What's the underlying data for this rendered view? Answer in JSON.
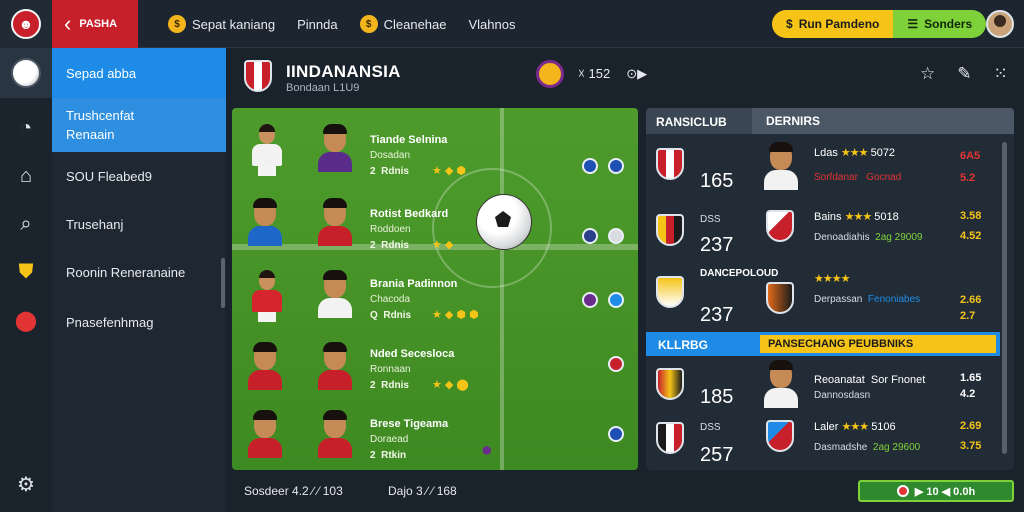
{
  "topbar": {
    "brand": "ᵹ̸ʜ",
    "brand_label": "PASHA",
    "nav": [
      {
        "label": "Sepat kaniang",
        "icon": "coin-icon"
      },
      {
        "label": "Pinnda",
        "icon": ""
      },
      {
        "label": "Cleanehae",
        "icon": "coin-icon"
      },
      {
        "label": "Vlahnos",
        "icon": ""
      }
    ],
    "pill_yellow": "Run Pamdeno",
    "pill_green": "Sonders"
  },
  "sidebar": {
    "items": [
      {
        "label": "Sepad abba"
      },
      {
        "label": "Trushcenfat Renaain"
      },
      {
        "label": "SOU Fleabed9"
      },
      {
        "label": "Trusehanj"
      },
      {
        "label": "Roonin Reneranaine"
      },
      {
        "label": "Pnasefenhmag"
      }
    ]
  },
  "header": {
    "title": "IINDANANSIA",
    "subtitle": "Bondaan L1U9",
    "stat_a": "☓ 152",
    "stat_b": "⊙▶"
  },
  "players": [
    {
      "name": "Tiande Selnina",
      "pos": "Dosadan",
      "num": "2",
      "extra": "Rdnis",
      "shirt": "#f2f2f2",
      "face_shirt": "#5a2c8a"
    },
    {
      "name": "Rotist Bedkard",
      "pos": "Roddoen",
      "num": "2",
      "extra": "Rdnis",
      "shirt": "#1d67c9",
      "face_shirt": "#c8202b"
    },
    {
      "name": "Brania Padinnon",
      "pos": "Chacoda",
      "num": "Q",
      "extra": "Rdnis",
      "shirt": "#d6252c",
      "face_shirt": "#f2f2f2"
    },
    {
      "name": "Nded Secesloca",
      "pos": "Ronnaan",
      "num": "2",
      "extra": "Rdnis",
      "shirt": "#c8202b",
      "face_shirt": "#c8202b"
    },
    {
      "name": "Brese Tigeama",
      "pos": "Doraead",
      "num": "2",
      "extra": "Rtkin",
      "shirt": "#c8202b",
      "face_shirt": "#c8202b"
    }
  ],
  "rpanel": {
    "tab_left": "RANSICLUB",
    "tab_right": "DERNIRS",
    "highlight_left": "KLLRBG",
    "highlight_right": "PANSECHANG PEUBBNIKS",
    "rows": [
      {
        "code": "",
        "big": "165",
        "line1": "Ldas",
        "stars": "★★★",
        "score": "5072",
        "line2": "Sorfdanar",
        "line2b": "Gocnad",
        "v1": "6A5",
        "v2": "5.2",
        "v1color": "#e23434",
        "v2color": "#e23434"
      },
      {
        "code": "DSS",
        "big": "237",
        "line1": "Bains",
        "stars": "★★★",
        "score": "5018",
        "line2": "Denoadiahis",
        "line2b": "2ag 29009",
        "v1": "3.58",
        "v2": "4.52",
        "v1color": "#f5c417",
        "v2color": "#f5c417"
      },
      {
        "code": "DANCEPOLOUD",
        "big": "237",
        "line1": "",
        "stars": "★★★★",
        "score": "",
        "line2": "Derpassan",
        "line2b": "Fenoniabes",
        "v1": "2.66",
        "v2": "2.7",
        "v1color": "#f5c417",
        "v2color": "#f5c417"
      },
      {
        "code": "",
        "big": "185",
        "line1": "Reoanatat",
        "stars": "",
        "score": "",
        "line2": "Dannosdasn",
        "line2b": "Sor Fnonet",
        "v1": "1.65",
        "v2": "4.2",
        "v1color": "#fff",
        "v2color": "#fff"
      },
      {
        "code": "DSS",
        "big": "257",
        "line1": "Laler",
        "stars": "★★★",
        "score": "5106",
        "line2": "Dasmadshe",
        "line2b": "2ag 29600",
        "v1": "2.69",
        "v2": "3.75",
        "v1color": "#f5c417",
        "v2color": "#f5c417"
      }
    ]
  },
  "footer": {
    "text_a": "Sosdeer 4.2 ⁄ ⁄ 103",
    "text_b": "Dajo 3 ⁄ ⁄ 168",
    "button": "▶ 10 ◀ 0.0h"
  }
}
